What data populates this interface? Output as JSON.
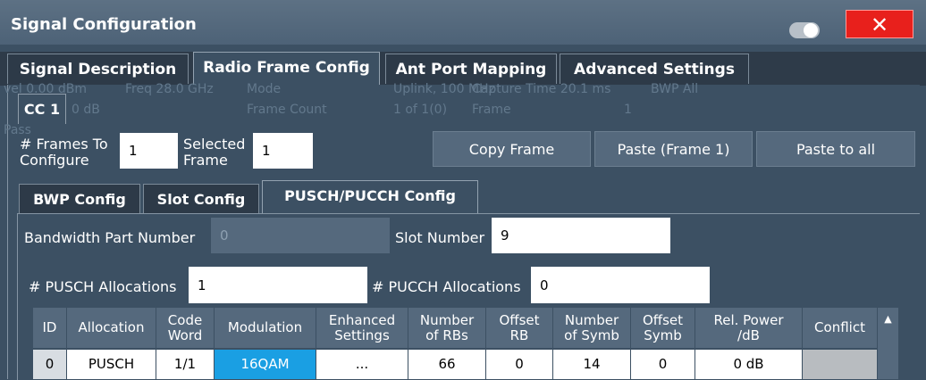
{
  "window": {
    "title": "Signal Configuration",
    "close": "✕"
  },
  "main_tabs": [
    "Signal Description",
    "Radio Frame Config",
    "Ant Port Mapping",
    "Advanced Settings"
  ],
  "background_info": {
    "row1": [
      "vel 0.00 dBm",
      "Freq 28.0 GHz",
      "Mode",
      "Uplink, 100 MHz",
      "Capture Time 20.1 ms",
      "BWP All"
    ],
    "row2": [
      "0 dB",
      "Frame Count",
      "1 of 1(0)",
      "Frame",
      "1"
    ],
    "row3": "Pass"
  },
  "cc_tab": "CC 1",
  "frames": {
    "label_line1": "# Frames To",
    "label_line2": "Configure",
    "value": "1"
  },
  "selected_frame": {
    "label_line1": "Selected",
    "label_line2": "Frame",
    "value": "1"
  },
  "buttons": {
    "copy": "Copy Frame",
    "paste": "Paste (Frame 1)",
    "paste_all": "Paste to all"
  },
  "sub_tabs": [
    "BWP Config",
    "Slot Config",
    "PUSCH/PUCCH Config"
  ],
  "bwp": {
    "label": "Bandwidth Part Number",
    "value": "0"
  },
  "slot": {
    "label": "Slot Number",
    "value": "9"
  },
  "pusch_alloc": {
    "label": "# PUSCH Allocations",
    "value": "1"
  },
  "pucch_alloc": {
    "label": "# PUCCH Allocations",
    "value": "0"
  },
  "table": {
    "headers": [
      [
        "ID"
      ],
      [
        "Allocation"
      ],
      [
        "Code",
        "Word"
      ],
      [
        "Modulation"
      ],
      [
        "Enhanced",
        "Settings"
      ],
      [
        "Number",
        "of RBs"
      ],
      [
        "Offset",
        "RB"
      ],
      [
        "Number",
        "of Symb"
      ],
      [
        "Offset",
        "Symb"
      ],
      [
        "Rel. Power",
        "/dB"
      ],
      [
        "Conflict"
      ]
    ],
    "rows": [
      [
        "0",
        "PUSCH",
        "1/1",
        "16QAM",
        "...",
        "66",
        "0",
        "14",
        "0",
        "0 dB",
        ""
      ]
    ]
  },
  "colors": {
    "accent": "#1a9fe3",
    "close": "#e8201c",
    "background": "#3c5063"
  }
}
